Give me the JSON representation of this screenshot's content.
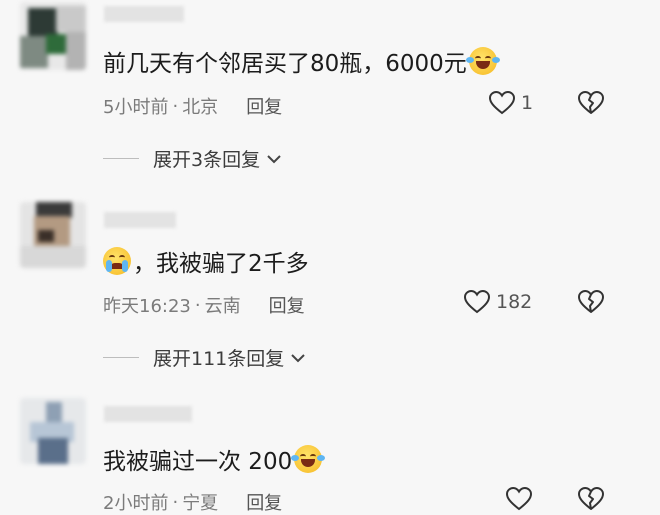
{
  "comments": [
    {
      "text": "前几天有个邻居买了80瓶，6000元",
      "emoji": "rofl-emoji",
      "time": "5小时前",
      "sep": "·",
      "location": "北京",
      "reply_label": "回复",
      "likes": "1",
      "replies_label": "展开3条回复"
    },
    {
      "text": "，我被骗了2千多",
      "emoji": "crying-emoji",
      "time": "昨天16:23",
      "sep": "·",
      "location": "云南",
      "reply_label": "回复",
      "likes": "182",
      "replies_label": "展开111条回复"
    },
    {
      "text": "我被骗过一次 200",
      "emoji": "rofl-emoji",
      "time": "2小时前",
      "sep": "·",
      "location": "宁夏",
      "reply_label": "回复",
      "likes": ""
    }
  ],
  "colors": {
    "background": "#f7f7f7",
    "text": "#1c1c1c",
    "meta": "#7b7b7b"
  },
  "icons": [
    "heart-icon",
    "broken-heart-icon",
    "chevron-down-icon"
  ]
}
